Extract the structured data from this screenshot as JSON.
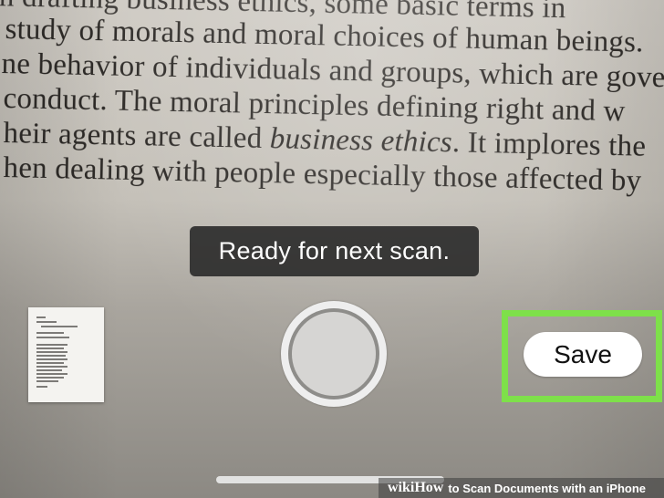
{
  "document_text": {
    "line1": "in drafting business ethics, some basic terms in",
    "line2": "study of morals and moral choices of human beings.",
    "line3": "ne behavior of individuals and groups, which are gover",
    "line4": "conduct. The moral principles defining right and w",
    "line5_before": "heir agents are called ",
    "line5_italic": "business ethics",
    "line5_after": ". It implores the",
    "line6": "hen dealing with people especially those affected by"
  },
  "scanner": {
    "toast": "Ready for next scan.",
    "save_label": "Save",
    "highlight_color": "#7ee04a"
  },
  "watermark": {
    "wiki": "wiki",
    "how": "How",
    "title": "to Scan Documents with an iPhone"
  }
}
